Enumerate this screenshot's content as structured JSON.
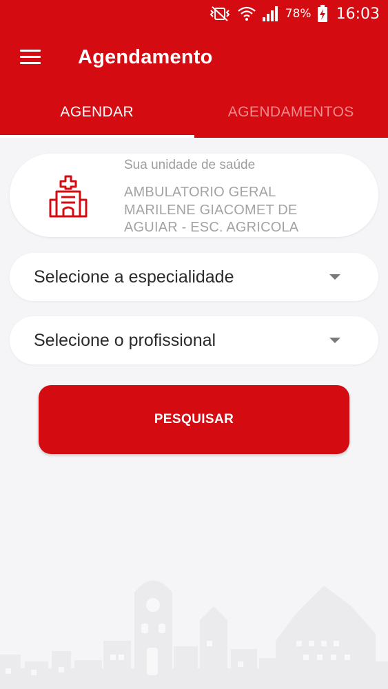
{
  "status_bar": {
    "battery_percent": "78%",
    "time": "16:03",
    "icons": [
      "vibrate-mute-icon",
      "wifi-icon",
      "signal-icon",
      "battery-charging-icon"
    ]
  },
  "app_bar": {
    "title": "Agendamento",
    "menu_icon": "hamburger-menu-icon"
  },
  "tabs": [
    {
      "label": "AGENDAR",
      "active": true
    },
    {
      "label": "AGENDAMENTOS",
      "active": false
    }
  ],
  "unit_card": {
    "caption": "Sua unidade de saúde",
    "name": "AMBULATORIO GERAL MARILENE GIACOMET DE AGUIAR - ESC. AGRICOLA",
    "icon": "hospital-icon"
  },
  "specialty_select": {
    "placeholder": "Selecione a especialidade"
  },
  "professional_select": {
    "placeholder": "Selecione o profissional"
  },
  "search_button": {
    "label": "PESQUISAR"
  },
  "colors": {
    "primary": "#d50b12",
    "background": "#f5f5f7",
    "inactive_tab": "#f08a8d",
    "skyline": "#ebebed"
  }
}
